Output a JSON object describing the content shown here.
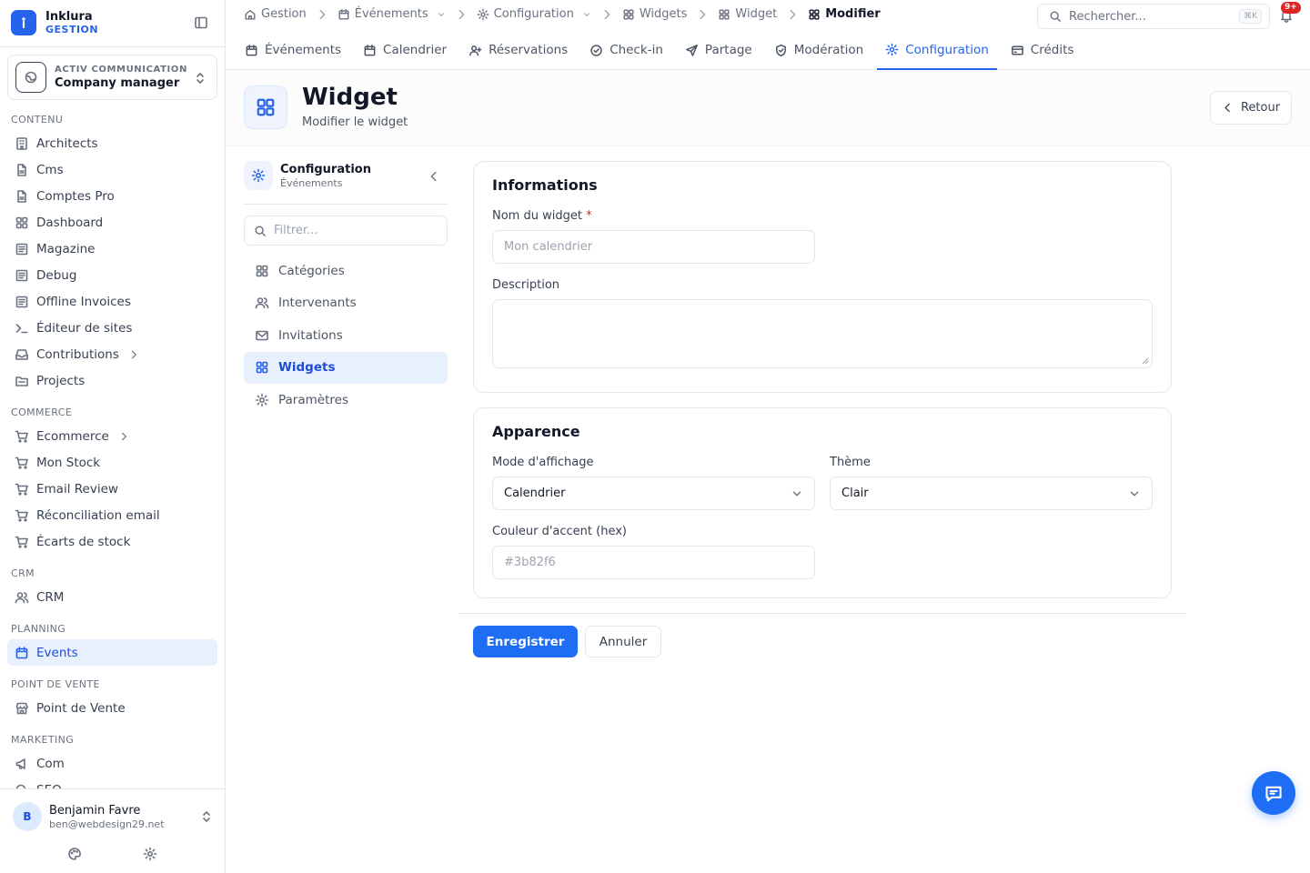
{
  "brand": {
    "name": "Inklura",
    "sub": "GESTION"
  },
  "company": {
    "org": "ACTIV COMMUNICATION",
    "role": "Company manager"
  },
  "sidebar": {
    "sections": [
      {
        "title": "CONTENU",
        "items": [
          {
            "label": "Architects",
            "icon": "building-icon"
          },
          {
            "label": "Cms",
            "icon": "file-icon"
          },
          {
            "label": "Comptes Pro",
            "icon": "file-icon"
          },
          {
            "label": "Dashboard",
            "icon": "grid-icon"
          },
          {
            "label": "Magazine",
            "icon": "newspaper-icon"
          },
          {
            "label": "Debug",
            "icon": "newspaper-icon"
          },
          {
            "label": "Offline Invoices",
            "icon": "newspaper-icon"
          },
          {
            "label": "Éditeur de sites",
            "icon": "terminal-icon"
          },
          {
            "label": "Contributions",
            "icon": "inbox-icon",
            "chevron": true
          },
          {
            "label": "Projects",
            "icon": "folder-icon"
          }
        ]
      },
      {
        "title": "COMMERCE",
        "items": [
          {
            "label": "Ecommerce",
            "icon": "cart-icon",
            "chevron": true
          },
          {
            "label": "Mon Stock",
            "icon": "cart-icon"
          },
          {
            "label": "Email Review",
            "icon": "cart-icon"
          },
          {
            "label": "Réconciliation email",
            "icon": "cart-icon"
          },
          {
            "label": "Écarts de stock",
            "icon": "cart-icon"
          }
        ]
      },
      {
        "title": "CRM",
        "items": [
          {
            "label": "CRM",
            "icon": "users-icon"
          }
        ]
      },
      {
        "title": "PLANNING",
        "items": [
          {
            "label": "Events",
            "icon": "calendar-icon",
            "active": true
          }
        ]
      },
      {
        "title": "POINT DE VENTE",
        "items": [
          {
            "label": "Point de Vente",
            "icon": "store-icon"
          }
        ]
      },
      {
        "title": "MARKETING",
        "items": [
          {
            "label": "Com",
            "icon": "megaphone-icon"
          },
          {
            "label": "SEO",
            "icon": "search-icon"
          }
        ]
      }
    ]
  },
  "user": {
    "initial": "B",
    "name": "Benjamin Favre",
    "email": "ben@webdesign29.net"
  },
  "breadcrumb": [
    {
      "label": "Gestion",
      "icon": "home-icon"
    },
    {
      "label": "Événements",
      "icon": "calendar-icon",
      "dropdown": true
    },
    {
      "label": "Configuration",
      "icon": "gear-icon",
      "dropdown": true
    },
    {
      "label": "Widgets",
      "icon": "grid-icon"
    },
    {
      "label": "Widget",
      "icon": "grid-icon"
    },
    {
      "label": "Modifier",
      "icon": "grid-icon",
      "current": true
    }
  ],
  "search": {
    "placeholder": "Rechercher...",
    "shortcut": "⌘K"
  },
  "notifications": {
    "badge": "9+"
  },
  "tabs": [
    {
      "label": "Événements",
      "icon": "calendar-icon"
    },
    {
      "label": "Calendrier",
      "icon": "calendar-icon"
    },
    {
      "label": "Réservations",
      "icon": "user-plus-icon"
    },
    {
      "label": "Check-in",
      "icon": "check-circle-icon"
    },
    {
      "label": "Partage",
      "icon": "send-icon"
    },
    {
      "label": "Modération",
      "icon": "shield-icon"
    },
    {
      "label": "Configuration",
      "icon": "gear-icon",
      "active": true
    },
    {
      "label": "Crédits",
      "icon": "credit-card-icon"
    }
  ],
  "page": {
    "title": "Widget",
    "subtitle": "Modifier le widget",
    "back_label": "Retour"
  },
  "subnav": {
    "title": "Configuration",
    "subtitle": "Événements",
    "filter_placeholder": "Filtrer...",
    "items": [
      {
        "label": "Catégories",
        "icon": "grid-icon"
      },
      {
        "label": "Intervenants",
        "icon": "users-icon"
      },
      {
        "label": "Invitations",
        "icon": "mail-icon"
      },
      {
        "label": "Widgets",
        "icon": "grid-icon",
        "active": true
      },
      {
        "label": "Paramètres",
        "icon": "gear-icon"
      }
    ]
  },
  "form": {
    "info": {
      "title": "Informations",
      "name_label": "Nom du widget",
      "name_required": "*",
      "name_placeholder": "Mon calendrier",
      "desc_label": "Description"
    },
    "appearance": {
      "title": "Apparence",
      "mode_label": "Mode d'affichage",
      "mode_value": "Calendrier",
      "theme_label": "Thème",
      "theme_value": "Clair",
      "accent_label": "Couleur d'accent (hex)",
      "accent_placeholder": "#3b82f6"
    },
    "save_label": "Enregistrer",
    "cancel_label": "Annuler"
  },
  "colors": {
    "accent": "#2563eb",
    "primary_button": "#1d6ef5",
    "badge": "#dc2626"
  }
}
